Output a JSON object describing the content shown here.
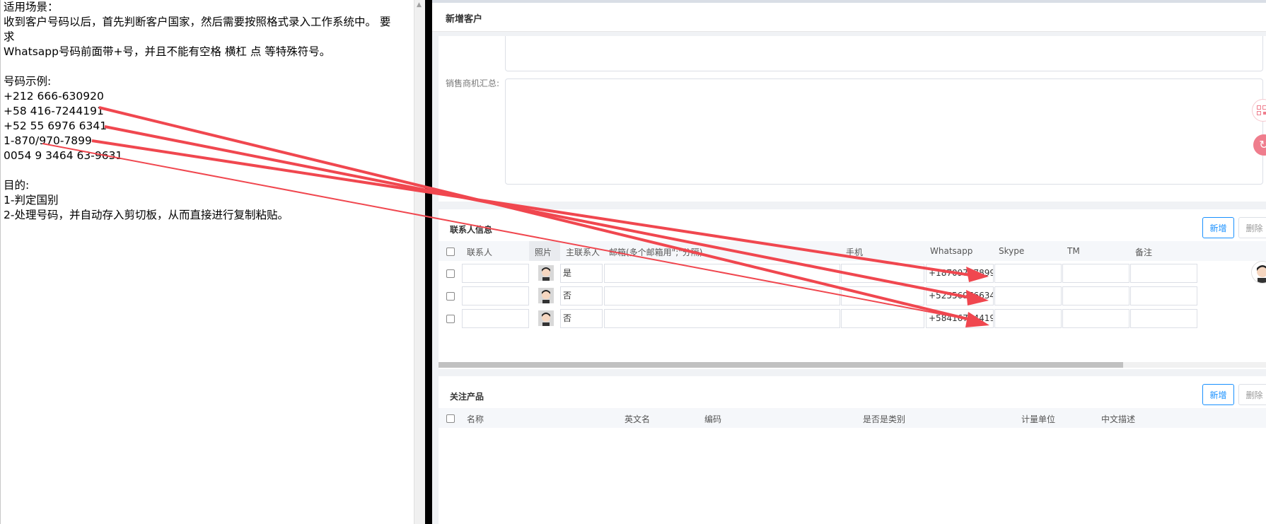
{
  "notes": {
    "lines": [
      "适用场景：",
      "收到客户号码以后，首先判断客户国家，然后需要按照格式录入工作系统中。 要",
      "求",
      "Whatsapp号码前面带+号，并且不能有空格 横杠 点 等特殊符号。",
      "",
      "号码示例:",
      "+212 666-630920",
      "+58 416-7244191",
      "+52 55 6976 6341",
      "1-870/970-7899",
      "0054 9 3464 63-9631",
      "",
      "目的:",
      "1-判定国别",
      "2-处理号码，并自动存入剪切板，从而直接进行复制粘贴。"
    ]
  },
  "app": {
    "header_title": "新增客户",
    "sales_label": "销售商机汇总:",
    "contacts": {
      "title": "联系人信息",
      "add_label": "新增",
      "delete_label": "删除",
      "columns": [
        "联系人",
        "照片",
        "主联系人",
        "邮箱(多个邮箱用\";\"分隔)",
        "手机",
        "Whatsapp",
        "Skype",
        "TM",
        "备注"
      ],
      "rows": [
        {
          "contact": "",
          "primary": "是",
          "email": "",
          "mobile": "",
          "whatsapp": "+18709707899",
          "skype": "",
          "tm": "",
          "note": ""
        },
        {
          "contact": "",
          "primary": "否",
          "email": "",
          "mobile": "",
          "whatsapp": "+525569766341",
          "skype": "",
          "tm": "",
          "note": ""
        },
        {
          "contact": "",
          "primary": "否",
          "email": "",
          "mobile": "",
          "whatsapp": "+584167244191",
          "skype": "",
          "tm": "",
          "note": ""
        }
      ]
    },
    "products": {
      "title": "关注产品",
      "add_label": "新增",
      "delete_label": "删除",
      "columns": [
        "名称",
        "英文名",
        "编码",
        "是否是类别",
        "计量单位",
        "中文描述"
      ]
    }
  },
  "icons": {
    "float_top": "qr-code-icon",
    "float_bottom": "refresh-icon",
    "profile": "user-avatar-icon",
    "row_photo": "person-avatar-icon"
  },
  "colors": {
    "arrow": "#f0474f",
    "primary": "#1890ff",
    "divider": "#000000"
  }
}
